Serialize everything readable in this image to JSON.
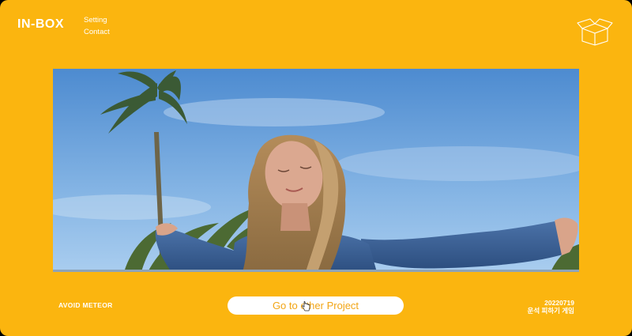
{
  "header": {
    "logo": "IN-BOX",
    "nav": [
      {
        "label": "Setting"
      },
      {
        "label": "Contact"
      }
    ],
    "box_icon": "open-box-icon"
  },
  "hero": {
    "image": "woman-arms-outstretched-palm-trees-blue-sky"
  },
  "footer": {
    "left_label": "AVOID METEOR",
    "button_label": "Go to other Project",
    "date": "20220719",
    "subtitle": "운석 피하기 게임"
  },
  "colors": {
    "background": "#fbb50f",
    "text": "#ffffff",
    "button_text": "#f2a515"
  }
}
